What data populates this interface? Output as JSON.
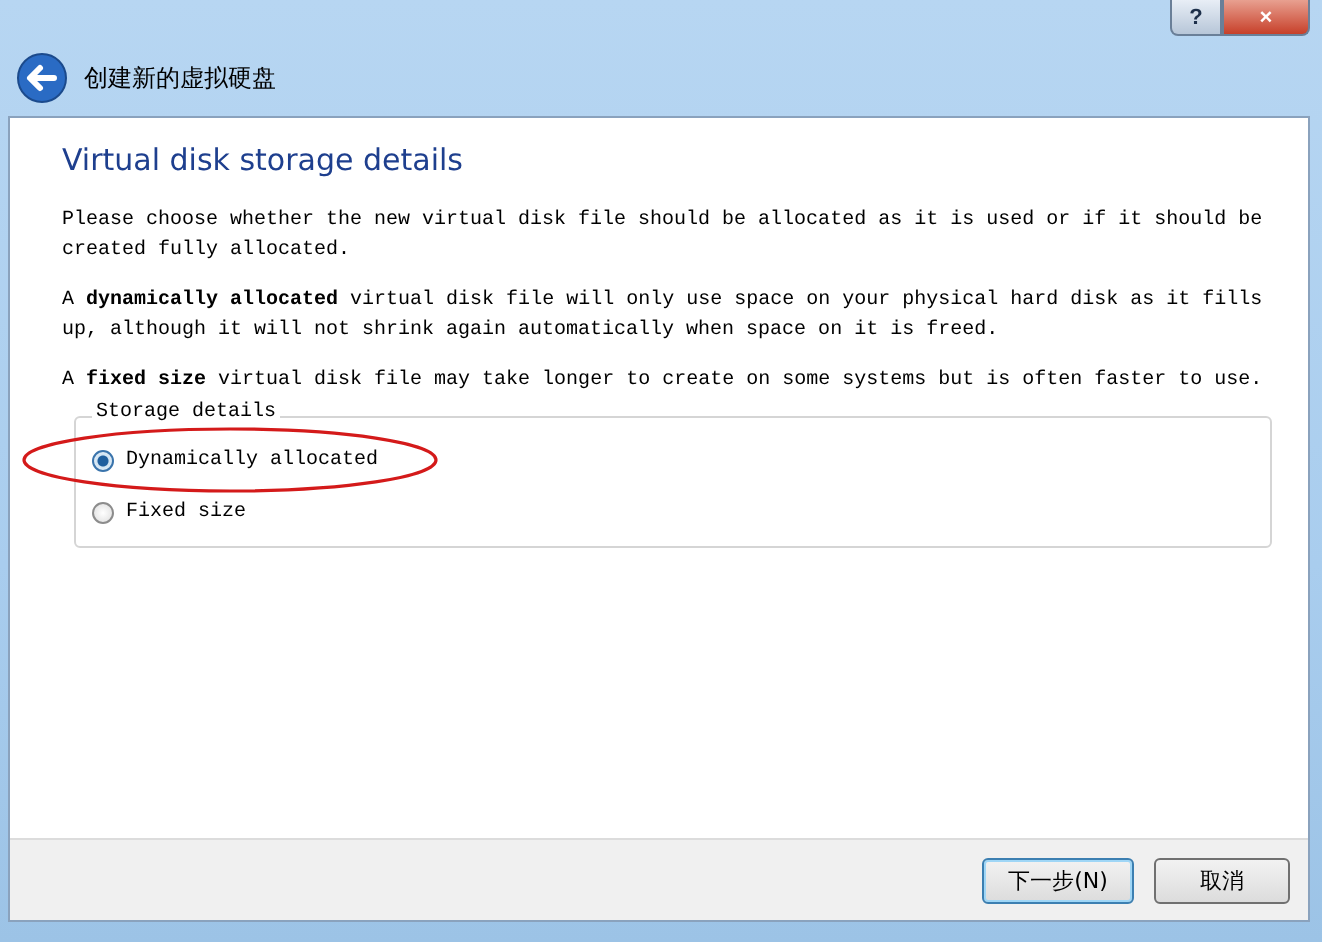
{
  "window": {
    "title": "创建新的虚拟硬盘",
    "controls": [
      "?",
      "×"
    ]
  },
  "heading": "Virtual disk storage details",
  "paragraphs": [
    "Please choose whether the new virtual disk file should be allocated as it is used or if it should be created fully allocated.",
    "A **dynamically allocated** virtual disk file will only use space on your physical hard disk as it fills up, although it will not shrink again automatically when space on it is freed.",
    "A **fixed size** virtual disk file may take longer to create on some systems but is often faster to use."
  ],
  "storage_group": {
    "title": "Storage details",
    "options": [
      {
        "label": "Dynamically allocated",
        "selected": true,
        "highlighted": true
      },
      {
        "label": "Fixed size",
        "selected": false,
        "highlighted": false
      }
    ]
  },
  "buttons": [
    {
      "label": "下一步(N)",
      "default": true
    },
    {
      "label": "取消",
      "default": false
    }
  ]
}
